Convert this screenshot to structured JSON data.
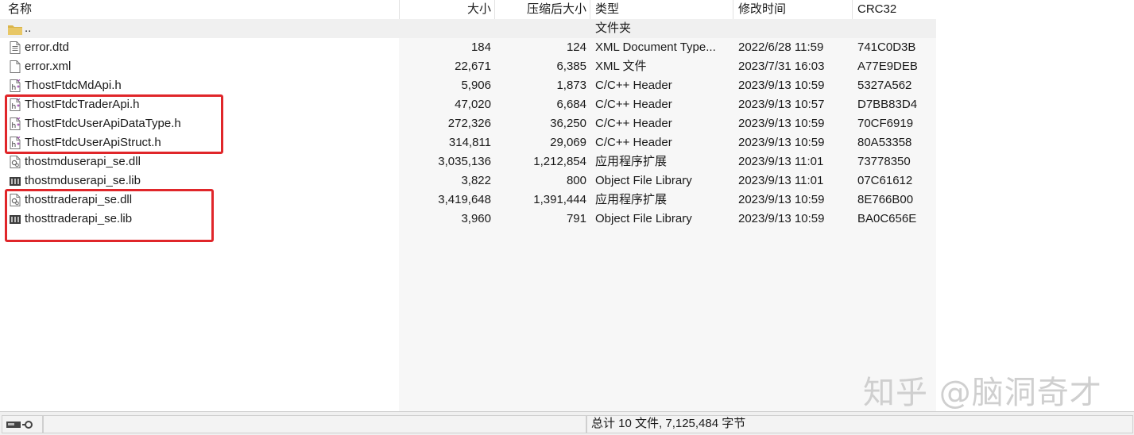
{
  "columns": {
    "name": "名称",
    "size": "大小",
    "packed": "压缩后大小",
    "type": "类型",
    "modified": "修改时间",
    "crc": "CRC32"
  },
  "parent_row": {
    "name": "..",
    "type": "文件夹"
  },
  "files": [
    {
      "name": "error.dtd",
      "size": "184",
      "packed": "124",
      "type": "XML Document Type...",
      "modified": "2022/6/28 11:59",
      "crc": "741C0D3B",
      "icon": "dtd-file-icon"
    },
    {
      "name": "error.xml",
      "size": "22,671",
      "packed": "6,385",
      "type": "XML 文件",
      "modified": "2023/7/31 16:03",
      "crc": "A77E9DEB",
      "icon": "xml-file-icon"
    },
    {
      "name": "ThostFtdcMdApi.h",
      "size": "5,906",
      "packed": "1,873",
      "type": "C/C++ Header",
      "modified": "2023/9/13 10:59",
      "crc": "5327A562",
      "icon": "header-file-icon"
    },
    {
      "name": "ThostFtdcTraderApi.h",
      "size": "47,020",
      "packed": "6,684",
      "type": "C/C++ Header",
      "modified": "2023/9/13 10:57",
      "crc": "D7BB83D4",
      "icon": "header-file-icon"
    },
    {
      "name": "ThostFtdcUserApiDataType.h",
      "size": "272,326",
      "packed": "36,250",
      "type": "C/C++ Header",
      "modified": "2023/9/13 10:59",
      "crc": "70CF6919",
      "icon": "header-file-icon"
    },
    {
      "name": "ThostFtdcUserApiStruct.h",
      "size": "314,811",
      "packed": "29,069",
      "type": "C/C++ Header",
      "modified": "2023/9/13 10:59",
      "crc": "80A53358",
      "icon": "header-file-icon"
    },
    {
      "name": "thostmduserapi_se.dll",
      "size": "3,035,136",
      "packed": "1,212,854",
      "type": "应用程序扩展",
      "modified": "2023/9/13 11:01",
      "crc": "73778350",
      "icon": "dll-file-icon"
    },
    {
      "name": "thostmduserapi_se.lib",
      "size": "3,822",
      "packed": "800",
      "type": "Object File Library",
      "modified": "2023/9/13 11:01",
      "crc": "07C61612",
      "icon": "lib-file-icon"
    },
    {
      "name": "thosttraderapi_se.dll",
      "size": "3,419,648",
      "packed": "1,391,444",
      "type": "应用程序扩展",
      "modified": "2023/9/13 10:59",
      "crc": "8E766B00",
      "icon": "dll-file-icon"
    },
    {
      "name": "thosttraderapi_se.lib",
      "size": "3,960",
      "packed": "791",
      "type": "Object File Library",
      "modified": "2023/9/13 10:59",
      "crc": "BA0C656E",
      "icon": "lib-file-icon"
    }
  ],
  "status": {
    "summary": "总计 10 文件, 7,125,484 字节"
  },
  "watermark": "知乎 @脑洞奇才",
  "colors": {
    "highlight": "#e0262a",
    "folder": "#d9b44a"
  }
}
